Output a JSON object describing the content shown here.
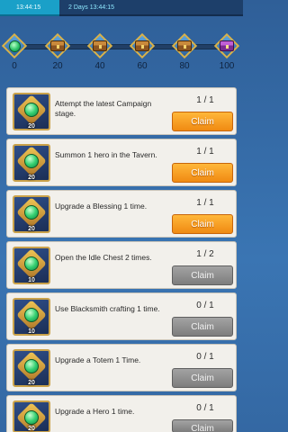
{
  "timers": {
    "left": "13:44:15",
    "right": "2 Days 13:44:15"
  },
  "milestones": [
    {
      "label": "0",
      "icon": "emerald-icon"
    },
    {
      "label": "20",
      "icon": "chest-icon"
    },
    {
      "label": "40",
      "icon": "chest-icon"
    },
    {
      "label": "60",
      "icon": "chest-icon"
    },
    {
      "label": "80",
      "icon": "chest-icon"
    },
    {
      "label": "100",
      "icon": "purple-chest-icon"
    }
  ],
  "quests": [
    {
      "reward": "20",
      "desc": "Attempt the latest Campaign stage.",
      "progress": "1 / 1",
      "button": "Claim",
      "state": "active"
    },
    {
      "reward": "20",
      "desc": "Summon 1 hero in the Tavern.",
      "progress": "1 / 1",
      "button": "Claim",
      "state": "active"
    },
    {
      "reward": "20",
      "desc": "Upgrade a Blessing 1 time.",
      "progress": "1 / 1",
      "button": "Claim",
      "state": "active"
    },
    {
      "reward": "10",
      "desc": "Open the Idle Chest 2 times.",
      "progress": "1 / 2",
      "button": "Claim",
      "state": "inactive"
    },
    {
      "reward": "10",
      "desc": "Use Blacksmith crafting 1 time.",
      "progress": "0 / 1",
      "button": "Claim",
      "state": "inactive"
    },
    {
      "reward": "20",
      "desc": "Upgrade a Totem 1 Time.",
      "progress": "0 / 1",
      "button": "Claim",
      "state": "inactive"
    },
    {
      "reward": "20",
      "desc": "Upgrade a Hero 1 time.",
      "progress": "0 / 1",
      "button": "Claim",
      "state": "inactive"
    }
  ],
  "colors": {
    "claim_active": "#f08a12",
    "claim_inactive": "#7d7d7d"
  }
}
